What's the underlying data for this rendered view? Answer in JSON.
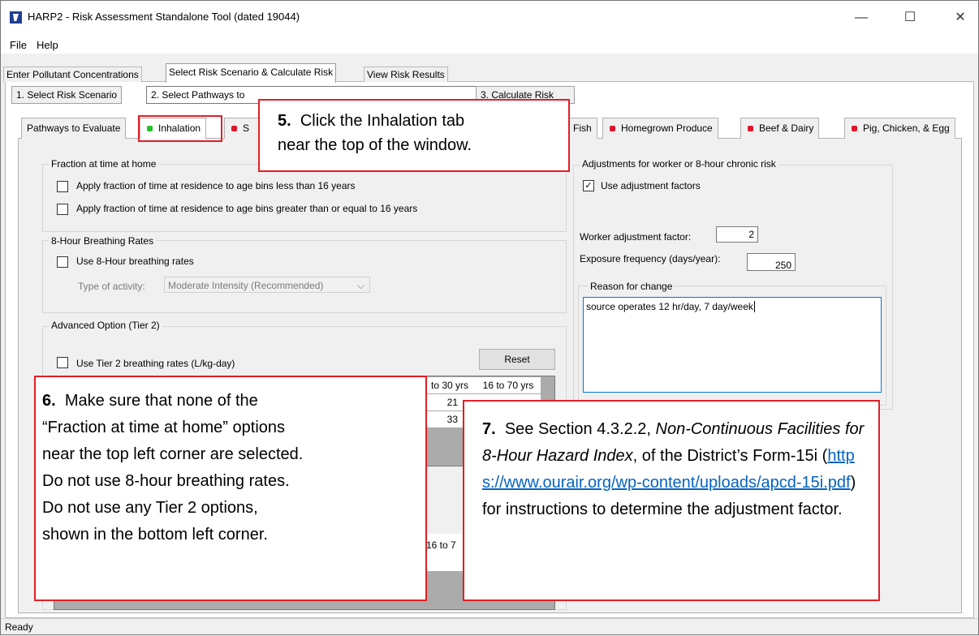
{
  "window": {
    "title": "HARP2 - Risk Assessment Standalone Tool (dated 19044)",
    "minimize": "—",
    "maximize": "☐",
    "close": "✕"
  },
  "menu": [
    "File",
    "Help"
  ],
  "main_tabs": [
    "Enter Pollutant Concentrations",
    "Select Risk Scenario & Calculate Risk",
    "View Risk Results"
  ],
  "sub_tabs": [
    "1. Select Risk Scenario",
    "2. Select Pathways to Evaluate & Receptor Type",
    "3. Calculate Risk"
  ],
  "sub_tabs_visible": [
    "1. Select Risk Scenario",
    "2. Select Pathways to",
    "3. Calculate Risk"
  ],
  "pathway_tabs": {
    "pathways": "Pathways to Evaluate",
    "inhalation": "Inhalation",
    "soil_partial": "S",
    "fish": "Fish",
    "produce": "Homegrown Produce",
    "beef": "Beef & Dairy",
    "pig": "Pig, Chicken, & Egg"
  },
  "colors": {
    "active_dot": "#21c22a",
    "inactive_dot": "#e0142a",
    "callout_border": "#e21f26",
    "link": "#0563c1"
  },
  "fraction_group": {
    "label": "Fraction at time at home",
    "opt1": "Apply fraction of time at residence to age bins less than 16 years",
    "opt2": "Apply fraction of time at residence to age bins greater than or equal to 16 years"
  },
  "breathing_group": {
    "label": "8-Hour Breathing Rates",
    "opt": "Use 8-Hour breathing rates",
    "activity_label": "Type of activity:",
    "activity_value": "Moderate Intensity (Recommended)"
  },
  "tier2_group": {
    "label": "Advanced Option (Tier 2)",
    "opt": "Use Tier 2 breathing rates (L/kg-day)",
    "reset": "Reset",
    "col_a": "to 30 yrs",
    "col_b": "16 to 70 yrs",
    "val1": "21",
    "val2": "33",
    "lower_col": "16 to 7"
  },
  "adjust_group": {
    "label": "Adjustments for worker or 8-hour chronic risk",
    "opt": "Use adjustment factors",
    "worker_label": "Worker adjustment factor:",
    "worker_value": "2",
    "exposure_label": "Exposure frequency (days/year):",
    "exposure_value": "250",
    "reason_label": "Reason for change",
    "reason_text": "source operates 12 hr/day, 7 day/week"
  },
  "callouts": {
    "c5_num": "5.",
    "c5_line1": "Click the Inhalation tab",
    "c5_line2": "near the top of the window.",
    "c6_num": "6.",
    "c6_line1": "Make sure that none of the",
    "c6_line2": "“Fraction at time at home” options",
    "c6_line3": "near the top left corner are selected.",
    "c6_line4": "Do not use 8-hour breathing rates.",
    "c6_line5": "Do not use any Tier 2 options,",
    "c6_line6": "shown in the bottom left corner.",
    "c7_num": "7.",
    "c7_text1": "See Section 4.3.2.2, ",
    "c7_italic": "Non-Continuous Facilities for 8-Hour Hazard Index",
    "c7_text2": ", of the District’s Form-15i (",
    "c7_link": "https://www.ourair.org/wp-content/uploads/apcd-15i.pdf",
    "c7_text3": ") for instructions to determine the adjustment factor."
  },
  "status": "Ready"
}
